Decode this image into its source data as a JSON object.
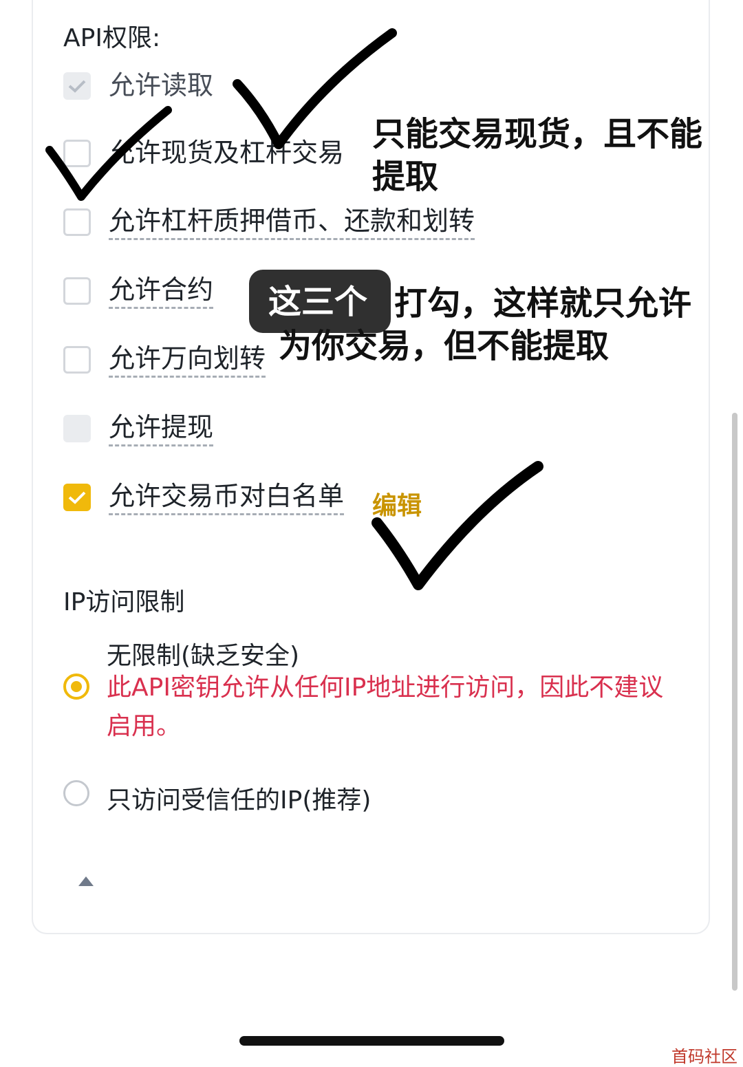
{
  "api_permissions": {
    "title": "API权限:",
    "items": [
      {
        "label": "允许读取",
        "state": "checked-disabled"
      },
      {
        "label": "允许现货及杠杆交易",
        "state": "unchecked"
      },
      {
        "label": "允许杠杆质押借币、还款和划转",
        "state": "unchecked"
      },
      {
        "label": "允许合约",
        "state": "unchecked"
      },
      {
        "label": "允许万向划转",
        "state": "unchecked"
      },
      {
        "label": "允许提现",
        "state": "disabled"
      },
      {
        "label": "允许交易币对白名单",
        "state": "checked"
      }
    ],
    "edit_label": "编辑"
  },
  "ip_restriction": {
    "title": "IP访问限制",
    "options": [
      {
        "title": "无限制(缺乏安全)",
        "warning": "此API密钥允许从任何IP地址进行访问，因此不建议启用。",
        "selected": true
      },
      {
        "title": "只访问受信任的IP(推荐)",
        "selected": false
      }
    ]
  },
  "annotations": {
    "note_top": "只能交易现货，且不能提取",
    "toast": "这三个",
    "note_middle": "打勾，这样就只允许为你交易，但不能提取"
  },
  "watermark": "首码社区",
  "colors": {
    "accent": "#f0b90b",
    "warning": "#d9304e",
    "edit": "#c99400"
  },
  "icons": {
    "collapse": "caret-up-icon",
    "check": "checkmark-icon"
  }
}
